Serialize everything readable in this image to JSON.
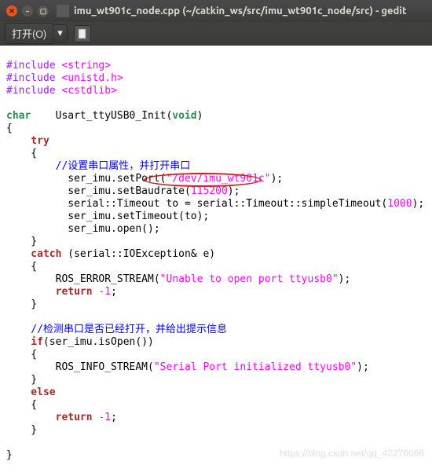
{
  "titlebar": {
    "title": "imu_wt901c_node.cpp (~/catkin_ws/src/imu_wt901c_node/src) - gedit"
  },
  "toolbar": {
    "open_label": "打开(O)",
    "open_arrow": "▾"
  },
  "code": {
    "inc1a": "#include ",
    "inc1b": "<string>",
    "inc2a": "#include ",
    "inc2b": "<unistd.h>",
    "inc3a": "#include ",
    "inc3b": "<cstdlib>",
    "char_kw": "char",
    "fn_name": "    Usart_ttyUSB0_Init(",
    "void_kw": "void",
    "fn_close": ")",
    "brace_open": "{",
    "try_kw": "    try",
    "brace_open2": "    {",
    "cmt1": "        //设置串口属性，并打开串口",
    "l1a": "          ser_imu.setPort(",
    "l1b": "\"/dev/imu_wt901c\"",
    "l1c": ");",
    "l2a": "          ser_imu.setBaudrate(",
    "l2b": "115200",
    "l2c": ");",
    "l3a": "          serial::Timeout to = serial::Timeout::simpleTimeout(",
    "l3b": "1000",
    "l3c": ");",
    "l4": "          ser_imu.setTimeout(to);",
    "l5": "          ser_imu.open();",
    "brace_close2": "    }",
    "catch_kw": "    catch",
    "catch_rest": " (serial::IOException& e)",
    "brace_open3": "    {",
    "l6a": "        ROS_ERROR_STREAM(",
    "l6b": "\"Unable to open port ttyusb0\"",
    "l6c": ");",
    "ret1a": "        return ",
    "ret1b": "-1",
    "ret1c": ";",
    "brace_close3": "    }",
    "cmt2": "    //检测串口是否已经打开，并给出提示信息",
    "if_kw": "    if",
    "if_rest": "(ser_imu.isOpen())",
    "brace_open4": "    {",
    "l7a": "        ROS_INFO_STREAM(",
    "l7b": "\"Serial Port initialized ttyusb0\"",
    "l7c": ");",
    "brace_close4": "    }",
    "else_kw": "    else",
    "brace_open5": "    {",
    "ret2a": "        return ",
    "ret2b": "-1",
    "ret2c": ";",
    "brace_close5": "    }",
    "brace_closef": "}"
  },
  "watermark": "https://blog.csdn.net/qq_42276066"
}
